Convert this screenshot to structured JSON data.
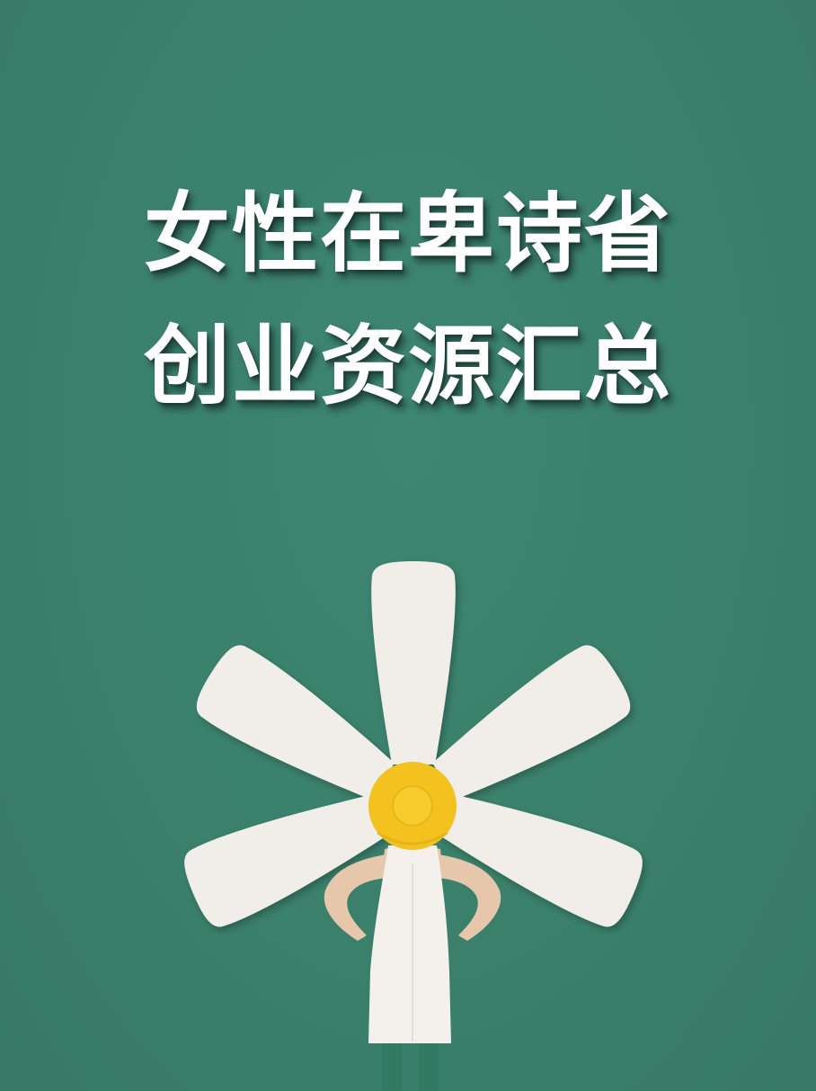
{
  "poster": {
    "title_line1": "女性在卑诗省",
    "title_line2": "创业资源汇总"
  },
  "colors": {
    "background": "#3a806b",
    "petal": "#f1eeea",
    "flower_center": "#f3c21f",
    "dress": "#f4f1ec",
    "skin": "#e7c7ac",
    "legs": "#2f7a60"
  },
  "icons": {
    "flower": "daisy-flower-icon",
    "person": "woman-in-yellow-hat-figure"
  }
}
